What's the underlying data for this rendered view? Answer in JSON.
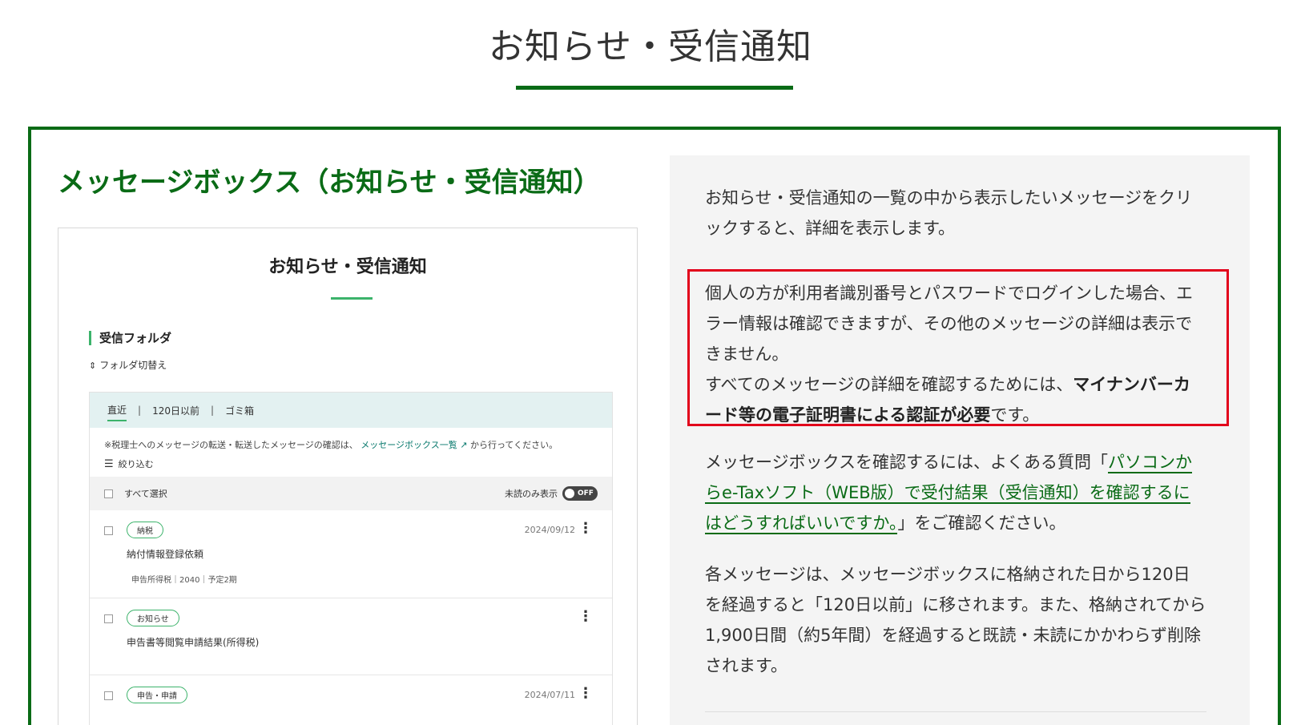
{
  "page": {
    "title": "お知らせ・受信通知"
  },
  "section": {
    "heading": "メッセージボックス（お知らせ・受信通知）"
  },
  "screenshot": {
    "title": "お知らせ・受信通知",
    "folder_heading": "受信フォルダ",
    "folder_switch": "フォルダ切替え",
    "tabs": [
      "直近",
      "120日以前",
      "ゴミ箱"
    ],
    "note_prefix": "※税理士へのメッセージの転送・転送したメッセージの確認は、",
    "note_link": "メッセージボックス一覧",
    "note_suffix": "から行ってください。",
    "filter_label": "絞り込む",
    "select_all": "すべて選択",
    "unread_only": "未読のみ表示",
    "toggle_label": "OFF",
    "messages": [
      {
        "badge": "納税",
        "date": "2024/09/12",
        "title": "納付情報登録依頼",
        "sub": "申告所得税｜2040｜予定2期"
      },
      {
        "badge": "お知らせ",
        "date": "",
        "title": "申告書等閲覧申請結果(所得税)",
        "sub": ""
      },
      {
        "badge": "申告・申請",
        "date": "2024/07/11",
        "title": "",
        "sub": ""
      }
    ]
  },
  "info": {
    "p1": "お知らせ・受信通知の一覧の中から表示したいメッセージをクリックすると、詳細を表示します。",
    "warn_text1": "個人の方が利用者識別番号とパスワードでログインした場合、エラー情報は確認できますが、その他のメッセージの詳細は表示できません。",
    "warn_text2": "すべてのメッセージの詳細を確認するためには、",
    "warn_bold": "マイナンバーカード等の電子証明書による認証が必要",
    "warn_text3": "です。",
    "p3_prefix": "メッセージボックスを確認するには、よくある質問「",
    "p3_link": "パソコンからe-Taxソフト（WEB版）で受付結果（受信通知）を確認するにはどうすればいいですか。",
    "p3_suffix": "」をご確認ください。",
    "p4": "各メッセージは、メッセージボックスに格納された日から120日を経過すると「120日以前」に移されます。また、格納されてから1,900日間（約5年間）を経過すると既読・未読にかかわらず削除されます。"
  },
  "colors": {
    "brand_green": "#0a6b16",
    "accent_green": "#3cb36b",
    "alert_red": "#e2001b"
  }
}
